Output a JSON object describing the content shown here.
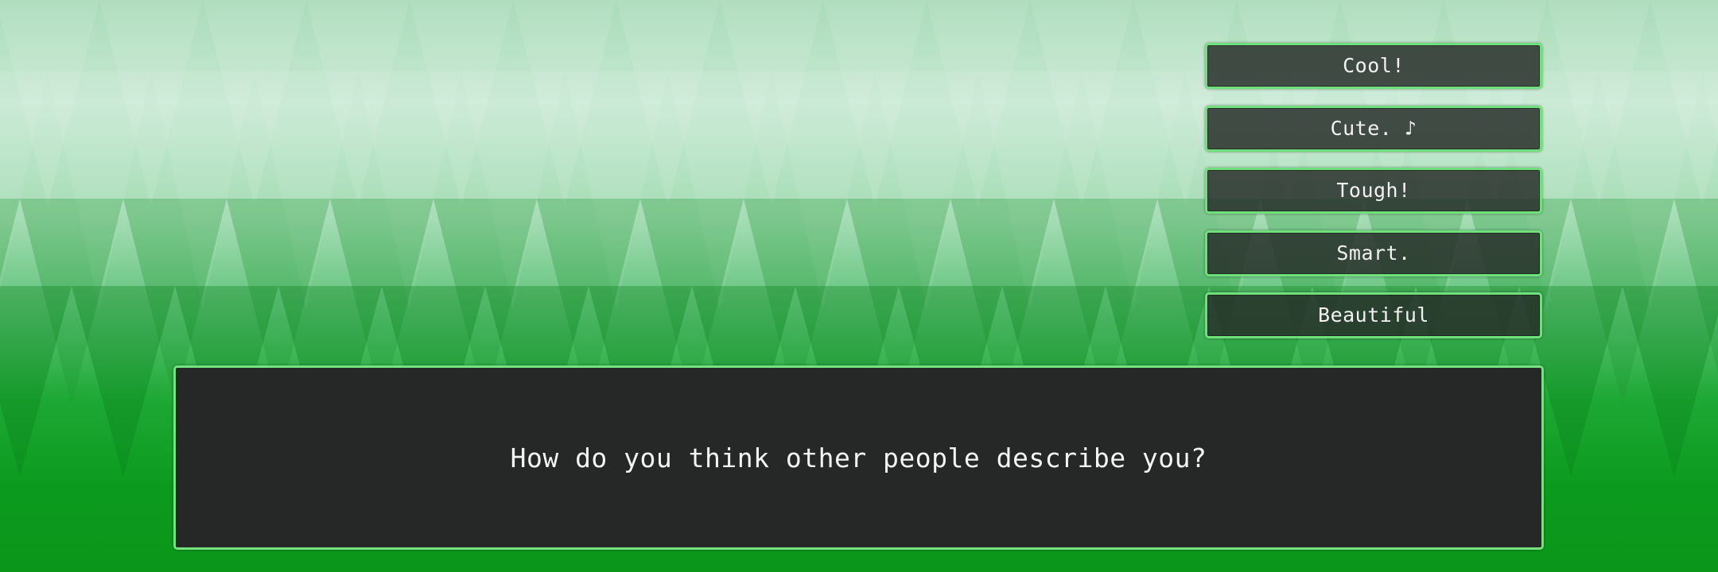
{
  "choices": [
    {
      "label": "Cool!"
    },
    {
      "label": "Cute. ♪"
    },
    {
      "label": "Tough!"
    },
    {
      "label": "Smart."
    },
    {
      "label": "Beautiful"
    }
  ],
  "dialog": {
    "text": "How do you think other people describe you?"
  },
  "colors": {
    "border": "#6fe07c",
    "panel": "#262827",
    "text": "#f2f2f2",
    "background_top": "#c7e9d3",
    "background_bottom": "#0a9619"
  }
}
